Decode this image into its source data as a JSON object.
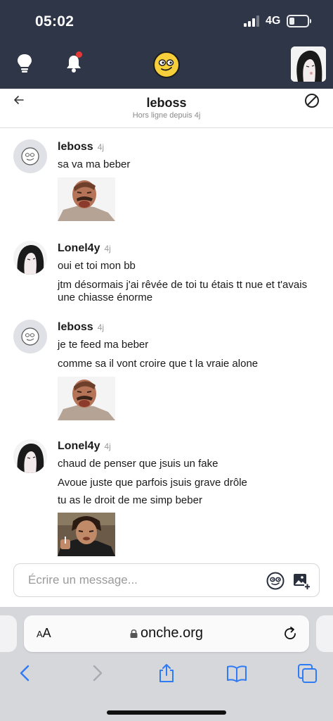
{
  "status_bar": {
    "time": "05:02",
    "network": "4G"
  },
  "app_header": {
    "icons": [
      "lightbulb-icon",
      "bell-icon",
      "onche-smiley-logo",
      "profile-avatar"
    ],
    "notification_dot_color": "#e53935"
  },
  "chat": {
    "back_icon": "arrow-left-icon",
    "title": "leboss",
    "subtitle": "Hors ligne depuis 4j",
    "block_icon": "block-icon"
  },
  "messages": [
    {
      "author": "leboss",
      "time": "4j",
      "lines": [
        "sa va ma beber"
      ],
      "sticker": "laughing-man-sticker"
    },
    {
      "author": "Lonel4y",
      "time": "4j",
      "lines": [
        "oui et toi mon bb",
        "jtm désormais j'ai rêvée de toi tu étais tt nue et t'avais une chiasse énorme"
      ],
      "sticker": null
    },
    {
      "author": "leboss",
      "time": "4j",
      "lines": [
        "je te feed ma beber",
        "comme sa il vont croire que t la vraie alone"
      ],
      "sticker": "laughing-man-sticker"
    },
    {
      "author": "Lonel4y",
      "time": "4j",
      "lines": [
        "chaud de penser que jsuis un fake",
        "Avoue juste que parfois jsuis grave drôle",
        "tu as le droit de me simp beber"
      ],
      "sticker": "smoking-man-sticker"
    }
  ],
  "composer": {
    "placeholder": "Écrire un message...",
    "emoji_icon": "smiley-icon",
    "image_icon": "add-image-icon"
  },
  "browser": {
    "text_size_label_small": "A",
    "text_size_label_large": "A",
    "url": "onche.org",
    "toolbar_icons": [
      "back-icon",
      "forward-icon",
      "share-icon",
      "bookmarks-icon",
      "tabs-icon"
    ],
    "accent": "#2f7bf5"
  },
  "colors": {
    "header_bg": "#2f3648",
    "logo_yellow": "#f6cf3a",
    "default_avatar": "#dfe1e6"
  }
}
